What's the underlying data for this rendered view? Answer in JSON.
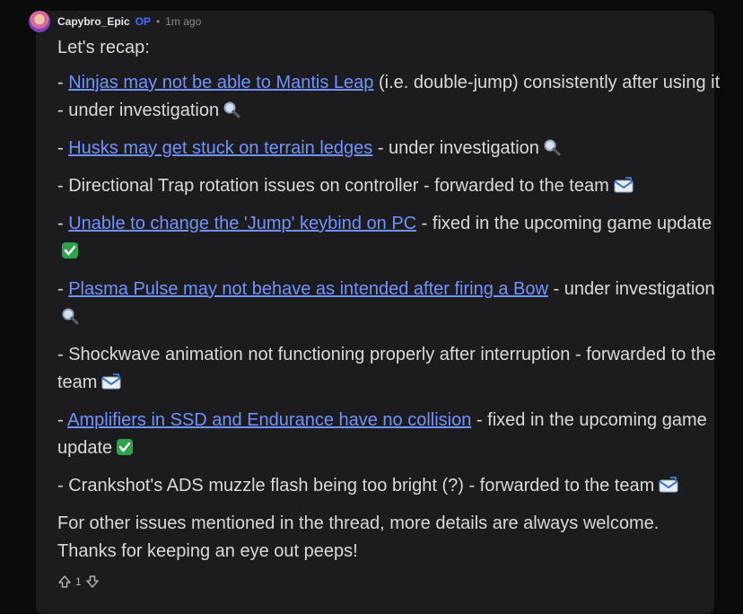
{
  "comment": {
    "username": "Capybro_Epic",
    "op_badge": "OP",
    "separator": "•",
    "time": "1m ago",
    "intro": "Let's recap:",
    "items": [
      {
        "prefix": "- ",
        "link": "Ninjas may not be able to Mantis Leap",
        "text": " (i.e. double-jump) consistently after using it - under investigation",
        "status_icon": "magnifier-icon"
      },
      {
        "prefix": "- ",
        "link": "Husks may get stuck on terrain ledges",
        "text": " - under investigation",
        "status_icon": "magnifier-icon"
      },
      {
        "prefix": "- ",
        "link": "",
        "text": "Directional Trap rotation issues on controller - forwarded to the team",
        "status_icon": "envelope-icon"
      },
      {
        "prefix": "- ",
        "link": "Unable to change the 'Jump' keybind on PC",
        "text": " - fixed in the upcoming game update",
        "status_icon": "check-icon"
      },
      {
        "prefix": "- ",
        "link": "Plasma Pulse may not behave as intended after firing a Bow",
        "text": " - under investigation",
        "status_icon": "magnifier-icon"
      },
      {
        "prefix": "- ",
        "link": "",
        "text": "Shockwave animation not functioning properly after interruption - forwarded to the team",
        "status_icon": "envelope-icon"
      },
      {
        "prefix": "- ",
        "link": "Amplifiers in SSD and Endurance have no collision",
        "text": " - fixed in the upcoming game update",
        "status_icon": "check-icon"
      },
      {
        "prefix": "- ",
        "link": "",
        "text": "Crankshot's ADS muzzle flash being too bright (?) - forwarded to the team",
        "status_icon": "envelope-icon"
      }
    ],
    "closing": "For other issues mentioned in the thread, more details are always welcome. Thanks for keeping an eye out peeps!",
    "vote_count": "1"
  }
}
